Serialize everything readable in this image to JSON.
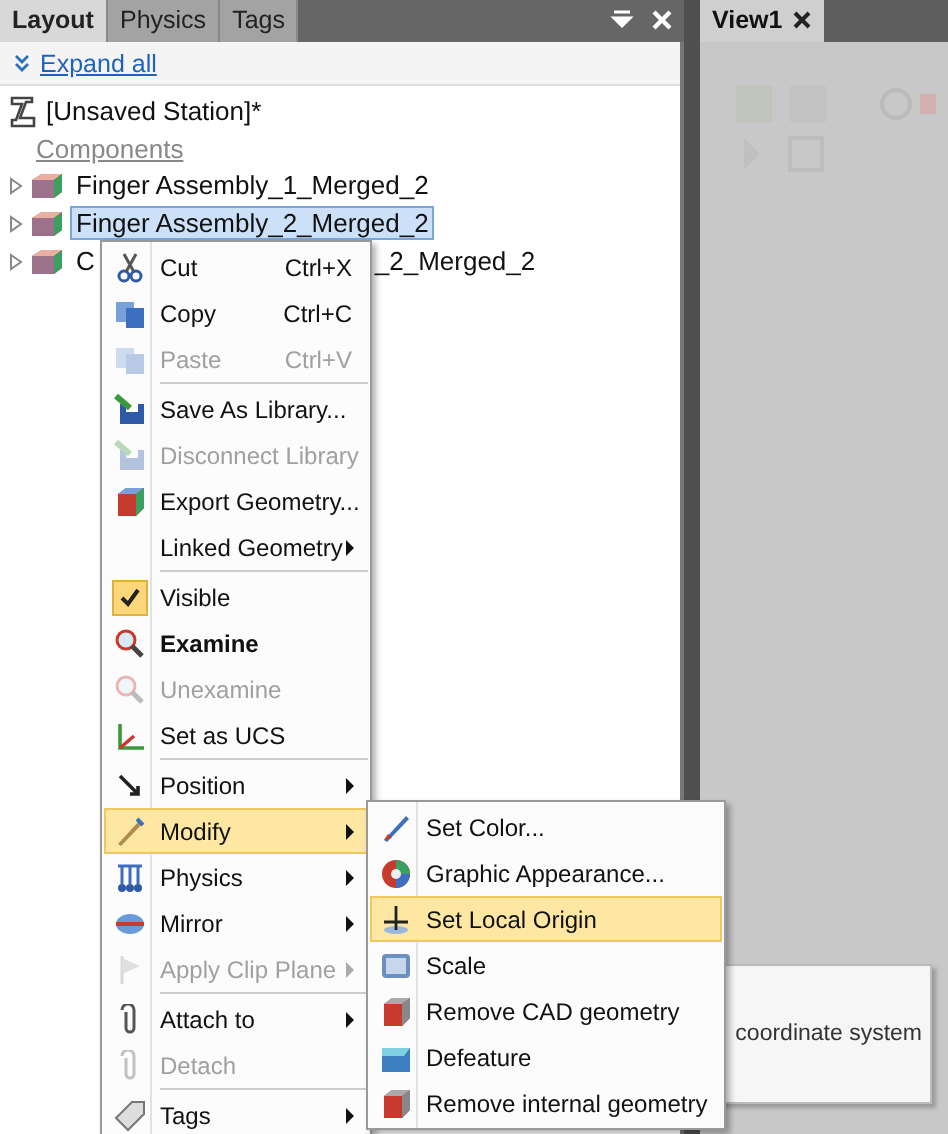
{
  "panel_tabs": [
    {
      "label": "Layout",
      "selected": true
    },
    {
      "label": "Physics",
      "selected": false
    },
    {
      "label": "Tags",
      "selected": false
    }
  ],
  "view_tabs": [
    {
      "label": "View1",
      "selected": true
    }
  ],
  "expand_all": "Expand all",
  "tree": {
    "root": "[Unsaved Station]*",
    "group": "Components",
    "items": [
      {
        "label": "Finger Assembly_1_Merged_2",
        "selected": false,
        "expanded": false
      },
      {
        "label": "Finger Assembly_2_Merged_2",
        "selected": true,
        "expanded": false
      },
      {
        "label": "C",
        "label_end": "_2_Merged_2",
        "selected": false,
        "expanded": false
      }
    ]
  },
  "context_menu": {
    "items": [
      {
        "kind": "command",
        "label": "Cut",
        "shortcut": "Ctrl+X",
        "disabled": false,
        "selected": false
      },
      {
        "kind": "command",
        "label": "Copy",
        "shortcut": "Ctrl+C",
        "disabled": false,
        "selected": false
      },
      {
        "kind": "command",
        "label": "Paste",
        "shortcut": "Ctrl+V",
        "disabled": true,
        "selected": false
      },
      {
        "kind": "separator"
      },
      {
        "kind": "command",
        "label": "Save As Library...",
        "disabled": false,
        "selected": false
      },
      {
        "kind": "command",
        "label": "Disconnect Library",
        "disabled": true,
        "selected": false
      },
      {
        "kind": "command",
        "label": "Export Geometry...",
        "disabled": false,
        "selected": false
      },
      {
        "kind": "command",
        "label": "Linked Geometry",
        "submenu": true,
        "disabled": false,
        "selected": false
      },
      {
        "kind": "separator"
      },
      {
        "kind": "command",
        "label": "Visible",
        "checked": true,
        "disabled": false,
        "selected": false
      },
      {
        "kind": "command",
        "label": "Examine",
        "default": true,
        "disabled": false,
        "selected": false
      },
      {
        "kind": "command",
        "label": "Unexamine",
        "disabled": true,
        "selected": false
      },
      {
        "kind": "command",
        "label": "Set as UCS",
        "disabled": false,
        "selected": false
      },
      {
        "kind": "separator"
      },
      {
        "kind": "command",
        "label": "Position",
        "submenu": true,
        "disabled": false,
        "selected": false
      },
      {
        "kind": "command",
        "label": "Modify",
        "submenu": true,
        "disabled": false,
        "selected": true
      },
      {
        "kind": "command",
        "label": "Physics",
        "submenu": true,
        "disabled": false,
        "selected": false
      },
      {
        "kind": "command",
        "label": "Mirror",
        "submenu": true,
        "disabled": false,
        "selected": false
      },
      {
        "kind": "command",
        "label": "Apply Clip Plane",
        "submenu": true,
        "disabled": true,
        "selected": false
      },
      {
        "kind": "separator"
      },
      {
        "kind": "command",
        "label": "Attach to",
        "submenu": true,
        "disabled": false,
        "selected": false
      },
      {
        "kind": "command",
        "label": "Detach",
        "disabled": true,
        "selected": false
      },
      {
        "kind": "separator"
      },
      {
        "kind": "command",
        "label": "Tags",
        "submenu": true,
        "disabled": false,
        "selected": false
      }
    ]
  },
  "submenu": {
    "items": [
      {
        "label": "Set Color...",
        "selected": false
      },
      {
        "label": "Graphic Appearance...",
        "selected": false
      },
      {
        "label": "Set Local Origin",
        "selected": true
      },
      {
        "label": "Scale",
        "selected": false
      },
      {
        "label": "Remove CAD geometry",
        "selected": false
      },
      {
        "label": "Defeature",
        "selected": false
      },
      {
        "label": "Remove internal geometry",
        "selected": false
      }
    ]
  },
  "tooltip": {
    "text": "coordinate system"
  }
}
